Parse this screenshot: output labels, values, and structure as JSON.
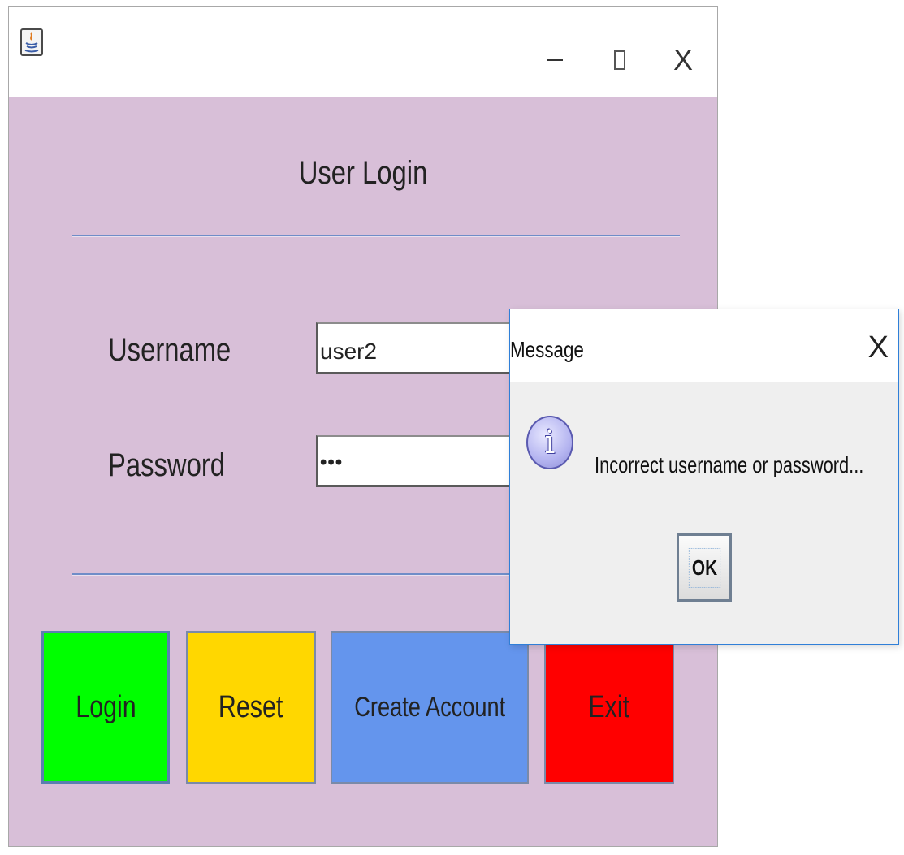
{
  "window": {
    "title": "",
    "background_color": "#d8bfd8"
  },
  "title_bar_controls": {
    "minimize": "–",
    "maximize": "☐",
    "close": "X"
  },
  "form": {
    "heading": "User Login",
    "username_label": "Username",
    "username_value": "user2",
    "password_label": "Password",
    "password_value": "•••"
  },
  "buttons": {
    "login": {
      "label": "Login",
      "color": "#00ff00"
    },
    "reset": {
      "label": "Reset",
      "color": "#ffd700"
    },
    "create_account": {
      "label": "Create Account",
      "color": "#6495ed"
    },
    "exit": {
      "label": "Exit",
      "color": "#ff0000"
    }
  },
  "dialog": {
    "title": "Message",
    "close": "X",
    "icon": "info-icon",
    "icon_glyph": "i",
    "message": "Incorrect username or password...",
    "ok_label": "OK"
  }
}
